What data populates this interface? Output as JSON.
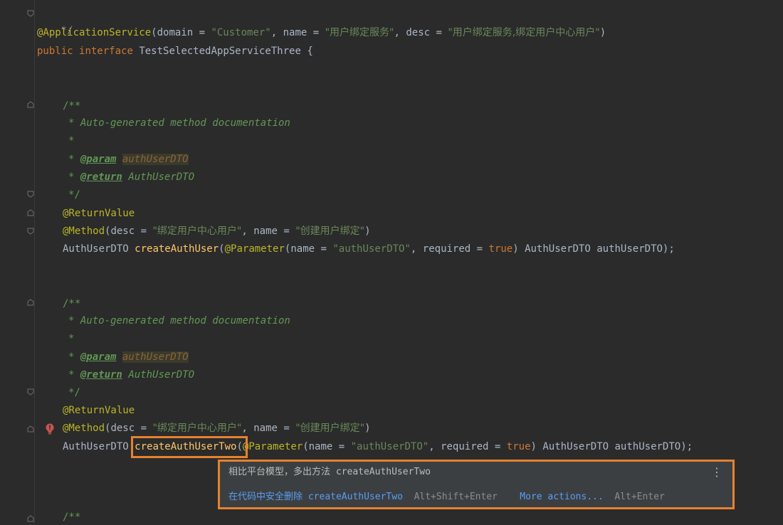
{
  "code": {
    "l1": "*/",
    "l2": {
      "ann": "@ApplicationService",
      "p1": "(domain = ",
      "s1": "\"Customer\"",
      "p2": ", name = ",
      "s2": "\"用户绑定服务\"",
      "p3": ", desc = ",
      "s3": "\"用户绑定服务,绑定用户中心用户\"",
      "p4": ")"
    },
    "l3": {
      "kw1": "public",
      "kw2": "interface",
      "name": "TestSelectedAppServiceThree",
      "brace": "{"
    },
    "doc": {
      "open": "/**",
      "summary": "* Auto-generated method documentation",
      "star": "*",
      "param_prefix": "* ",
      "param_tag": "@param",
      "param_ref": "authUserDTO",
      "return_prefix": "* ",
      "return_tag": "@return",
      "return_type": "AuthUserDTO",
      "close": "*/"
    },
    "m1": {
      "ret_ann": "@ReturnValue",
      "method_ann": "@Method",
      "mp1": "(desc = ",
      "ms1": "\"绑定用户中心用户\"",
      "mp2": ", name = ",
      "ms2": "\"创建用户绑定\"",
      "mp3": ")",
      "rtype": "AuthUserDTO",
      "fname": "createAuthUser",
      "open": "(",
      "param_ann": "@Parameter",
      "pp1": "(name = ",
      "ps1": "\"authUserDTO\"",
      "pp2": ", required = ",
      "pbool": "true",
      "pp3": ") AuthUserDTO authUserDTO);"
    },
    "m2": {
      "ret_ann": "@ReturnValue",
      "method_ann": "@Method",
      "mp1": "(desc = ",
      "ms1": "\"绑定用户中心用户\"",
      "mp2": ", name = ",
      "ms2": "\"创建用户绑定\"",
      "mp3": ")",
      "rtype": "AuthUserDTO",
      "fname": "createAuthUserTwo",
      "open": "(",
      "param_ann": "@Parameter",
      "pp1": "(name = ",
      "ps1": "\"authUserDTO\"",
      "pp2": ", required = ",
      "pbool": "true",
      "pp3": ") AuthUserDTO authUserDTO);"
    },
    "last_doc_open": "/**"
  },
  "popup": {
    "message_zh": "相比平台模型，多出方法",
    "message_method": "createAuthUserTwo",
    "action_zh": "在代码中安全删除",
    "action_method": "createAuthUserTwo",
    "action_shortcut": "Alt+Shift+Enter",
    "more_actions": "More actions...",
    "more_shortcut": "Alt+Enter",
    "kebab": "⋮"
  },
  "colors": {
    "background": "#2b2b2b",
    "highlight_box": "#e5822f",
    "annotation": "#bbb529",
    "string": "#6a8759",
    "keyword": "#cc7832",
    "method": "#ffc66d",
    "link": "#589df6"
  },
  "icons": {
    "gutter_fold": "fold-marker-icon",
    "intention": "error-bulb-icon",
    "menu": "more-vertical-icon"
  }
}
